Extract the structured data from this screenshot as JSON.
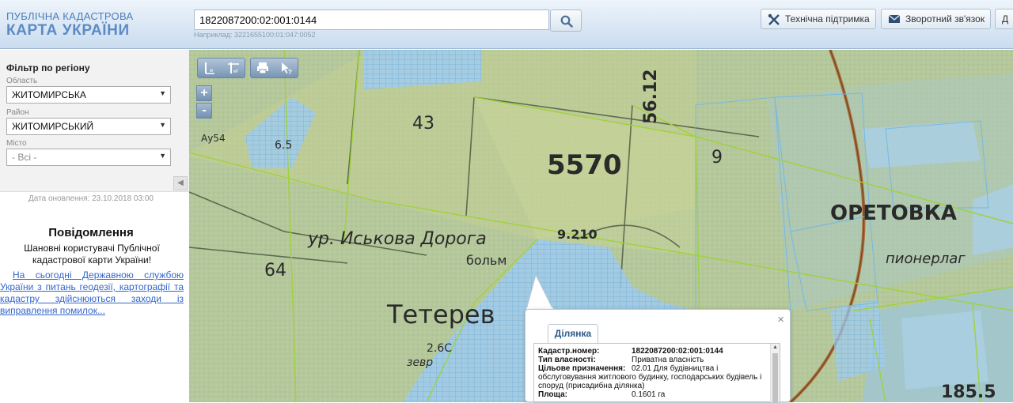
{
  "header": {
    "logo_line1": "ПУБЛІЧНА КАДАСТРОВА",
    "logo_line2": "КАРТА УКРАЇНИ",
    "search_value": "1822087200:02:001:0144",
    "search_hint": "Наприклад: 3221655100:01:047:0052",
    "support_label": "Технічна підтримка",
    "feedback_label": "Зворотний зв'язок",
    "cut_label": "Д"
  },
  "sidebar": {
    "filter_title": "Фільтр по регіону",
    "oblast_label": "Область",
    "oblast_value": "ЖИТОМИРСЬКА",
    "rayon_label": "Район",
    "rayon_value": "ЖИТОМИРСЬКИЙ",
    "misto_label": "Місто",
    "misto_value": "- Всі -",
    "updated": "Дата оновлення: 23.10.2018 03:00",
    "notice_title": "Повідомлення",
    "notice_text": "Шановні користувачі Публічної кадастрової карти України!",
    "notice_link": "На сьогодні Державною службою України з питань геодезії, картографії та кадастру здійснюються заходи із виправлення помилок..."
  },
  "map": {
    "labels": [
      "43",
      "5570",
      "9",
      "56.12",
      "ур. Иськова Дорога",
      "64",
      "Тетерев",
      "больм",
      "9.210",
      "2.6С",
      "зевр",
      "185.5",
      "ОРЕТОВКА",
      "пионерлаг",
      "Ау54",
      "6.5"
    ],
    "toolbar": [
      "I м",
      "I м²",
      "print",
      "info"
    ],
    "zoom_in": "+",
    "zoom_out": "-"
  },
  "popup": {
    "tab": "Ділянка",
    "close": "×",
    "rows": [
      {
        "k": "Кадастр.номер:",
        "v": "1822087200:02:001:0144",
        "bold": true
      },
      {
        "k": "Тип власності:",
        "v": "Приватна власність"
      },
      {
        "k": "Цільове призначення:",
        "v": "02.01 Для будівництва і"
      },
      {
        "k": "",
        "v": "обслуговування житлового будинку, господарських будівель і"
      },
      {
        "k": "",
        "v": "споруд (присадибна ділянка)"
      },
      {
        "k": "Площа:",
        "v": "0.1601 га"
      }
    ]
  },
  "colors": {
    "map_green": "#b7c99f",
    "parcel_blue": "#8ec5ec",
    "boundary_green": "#9fd23a",
    "link": "#3366cc"
  }
}
